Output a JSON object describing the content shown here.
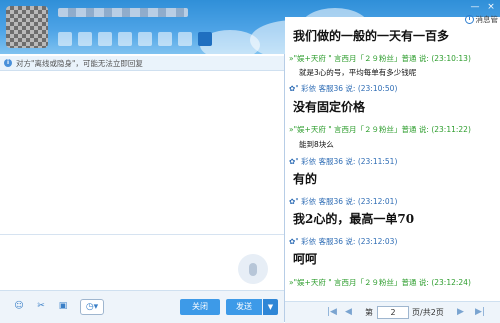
{
  "window": {
    "minimize": "—",
    "close": "×"
  },
  "left": {
    "notice": "对方\"离线或隐身\"，可能无法立即回复",
    "buttons": {
      "close": "关闭",
      "send": "发送",
      "send_dropdown": "▼"
    },
    "toolbar_icons": [
      "emoji-icon",
      "screenshot-icon",
      "image-icon",
      "history-clock-icon"
    ]
  },
  "right": {
    "message_manager": "消息管",
    "messages": [
      {
        "type": "big",
        "text": "我们做的一般的一天有一百多"
      },
      {
        "type": "header_green",
        "text": "»\"娱+天府 \" 言西月「２９粉丝」普通 说: (23:10:13)"
      },
      {
        "type": "small",
        "text": "就是3心的号，平均每单有多少钱呢"
      },
      {
        "type": "header_blue",
        "text": "✿\" 彩依 客服36 说: (23:10:50)"
      },
      {
        "type": "big",
        "text": "没有固定价格"
      },
      {
        "type": "header_green",
        "text": "»\"娱+天府 \" 言西月「２９粉丝」普通 说: (23:11:22)"
      },
      {
        "type": "small",
        "text": "能到8块么"
      },
      {
        "type": "header_blue",
        "text": "✿\" 彩依 客服36 说: (23:11:51)"
      },
      {
        "type": "big",
        "text": "有的"
      },
      {
        "type": "header_blue",
        "text": "✿\" 彩依 客服36 说: (23:12:01)"
      },
      {
        "type": "big",
        "text": "我2心的，最高一单70"
      },
      {
        "type": "header_blue",
        "text": "✿\" 彩依 客服36 说: (23:12:03)"
      },
      {
        "type": "big",
        "text": "呵呵"
      },
      {
        "type": "header_green",
        "text": "»\"娱+天府 \" 言西月「２９粉丝」普通 说: (23:12:24)"
      }
    ],
    "pager": {
      "first": "|◀",
      "prev": "◀",
      "page_label": "第",
      "page_value": "2",
      "page_total": "页/共2页",
      "next": "▶",
      "last": "▶|"
    }
  }
}
